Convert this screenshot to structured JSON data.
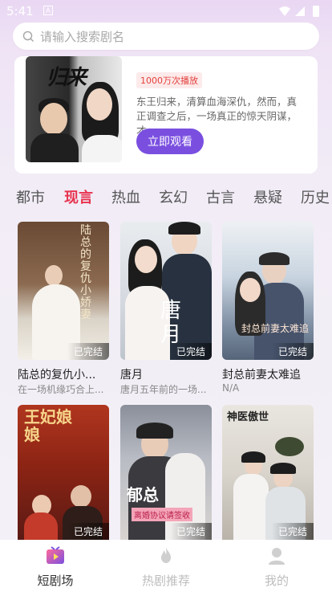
{
  "status": {
    "time": "5:41",
    "notif": "A"
  },
  "search": {
    "placeholder": "请输入搜索剧名"
  },
  "featured": {
    "poster_title": "归来",
    "badge": "1000万次播放",
    "description": "东王归来，清算血海深仇，然而，真正调查之后，一场真正的惊天阴谋，才...",
    "watch_label": "立即观看"
  },
  "categories": [
    "都市",
    "现言",
    "热血",
    "玄幻",
    "古言",
    "悬疑",
    "历史"
  ],
  "active_category": "现言",
  "dramas": [
    {
      "title": "陆总的复仇小...",
      "subtitle": "在一场机缘巧合上...",
      "status": "已完结"
    },
    {
      "title": "唐月",
      "subtitle": "唐月五年前的一场...",
      "status": "已完结"
    },
    {
      "title": "封总前妻太难追",
      "subtitle": "N/A",
      "status": "已完结"
    },
    {
      "title": "",
      "subtitle": "",
      "status": "已完结"
    },
    {
      "title": "",
      "subtitle": "",
      "status": "已完结"
    },
    {
      "title": "",
      "subtitle": "",
      "status": "已完结"
    }
  ],
  "poster_texts": [
    "陆总的复仇小娇妻",
    "唐月",
    "封总前妻太难追",
    "王妃娘娘",
    "郁总",
    "离婚协议请签收",
    "神医傲世"
  ],
  "nav": [
    {
      "label": "短剧场",
      "icon": "tv-icon",
      "active": true
    },
    {
      "label": "热剧推荐",
      "icon": "flame-icon",
      "active": false
    },
    {
      "label": "我的",
      "icon": "user-icon",
      "active": false
    }
  ],
  "colors": {
    "accent": "#7a4fe0",
    "category_active": "#e8334f",
    "badge_text": "#e2403d"
  }
}
